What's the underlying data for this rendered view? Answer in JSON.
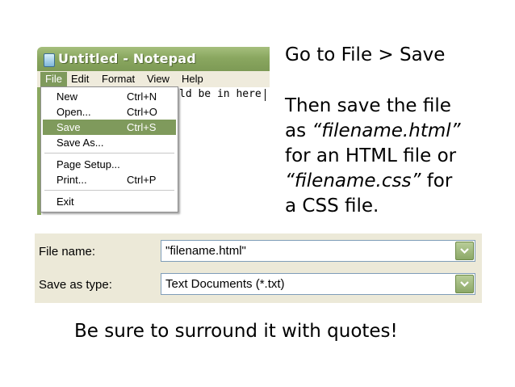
{
  "notepad": {
    "title": "Untitled - Notepad",
    "menus": [
      "File",
      "Edit",
      "Format",
      "View",
      "Help"
    ],
    "editor_text": "ld be in here",
    "file_menu": {
      "items": [
        {
          "label": "New",
          "shortcut": "Ctrl+N"
        },
        {
          "label": "Open...",
          "shortcut": "Ctrl+O"
        },
        {
          "label": "Save",
          "shortcut": "Ctrl+S",
          "highlighted": true
        },
        {
          "label": "Save As...",
          "shortcut": ""
        },
        {
          "label": "Page Setup...",
          "shortcut": ""
        },
        {
          "label": "Print...",
          "shortcut": "Ctrl+P"
        },
        {
          "label": "Exit",
          "shortcut": ""
        }
      ]
    },
    "colors": {
      "titlebar": "#8aa760",
      "highlight": "#7f9a5c",
      "menubar": "#efebdc"
    }
  },
  "instructions": {
    "line1": "Go to File > Save",
    "line2": "Then save the file",
    "line3_prefix": "as ",
    "line3_italic": "“filename.html”",
    "line4": "for an HTML file or",
    "line5_italic": "“filename.css”",
    "line5_suffix": " for",
    "line6": "a CSS file."
  },
  "save_dialog": {
    "file_name_label": "File name:",
    "file_name_value": "\"filename.html\"",
    "save_as_type_label": "Save as type:",
    "save_as_type_value": "Text Documents (*.txt)",
    "colors": {
      "panel": "#ece9d8",
      "button": "#8ca868"
    }
  },
  "note": "Be sure to surround it with quotes!"
}
